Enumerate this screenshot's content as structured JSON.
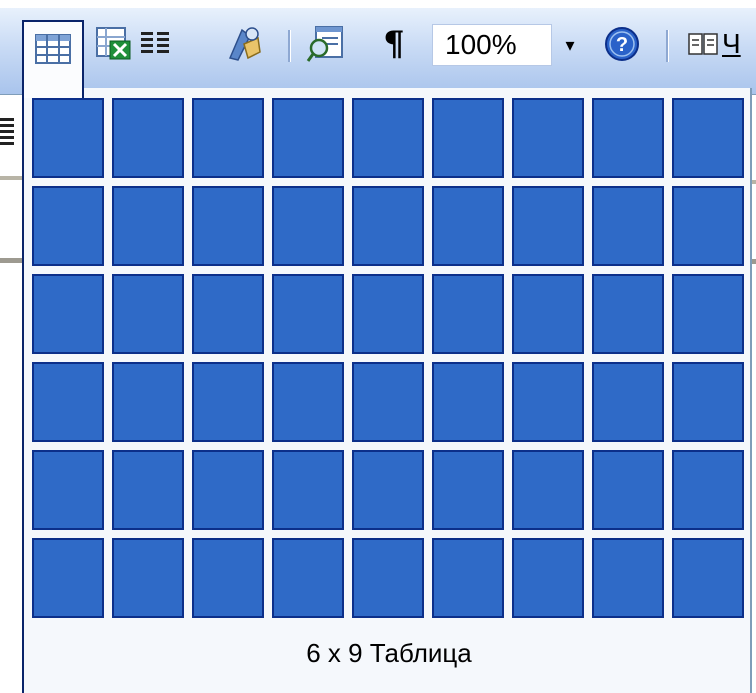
{
  "toolbar": {
    "buttons": [
      {
        "name": "insert-table-button",
        "icon": "table-grid-icon"
      },
      {
        "name": "insert-excel-sheet-button",
        "icon": "excel-sheet-icon"
      },
      {
        "name": "columns-button",
        "icon": "columns-icon"
      },
      {
        "name": "drawing-button",
        "icon": "drawing-icon"
      },
      {
        "name": "document-map-button",
        "icon": "document-map-icon"
      },
      {
        "name": "show-formatting-button",
        "icon": "pilcrow-icon",
        "glyph": "¶"
      },
      {
        "name": "help-button",
        "icon": "help-icon",
        "glyph": "?"
      },
      {
        "name": "reading-mode-button",
        "icon": "book-icon"
      }
    ],
    "zoom_value": "100%",
    "zoom_arrow": "▾",
    "reading_label": "Ч"
  },
  "table_picker": {
    "rows": 6,
    "columns": 9,
    "status": "6 x 9 Таблица",
    "selected_color": "#2f6ac7",
    "border_color": "#0c2f8a"
  },
  "background": {
    "left_glyph_lines": 5
  }
}
